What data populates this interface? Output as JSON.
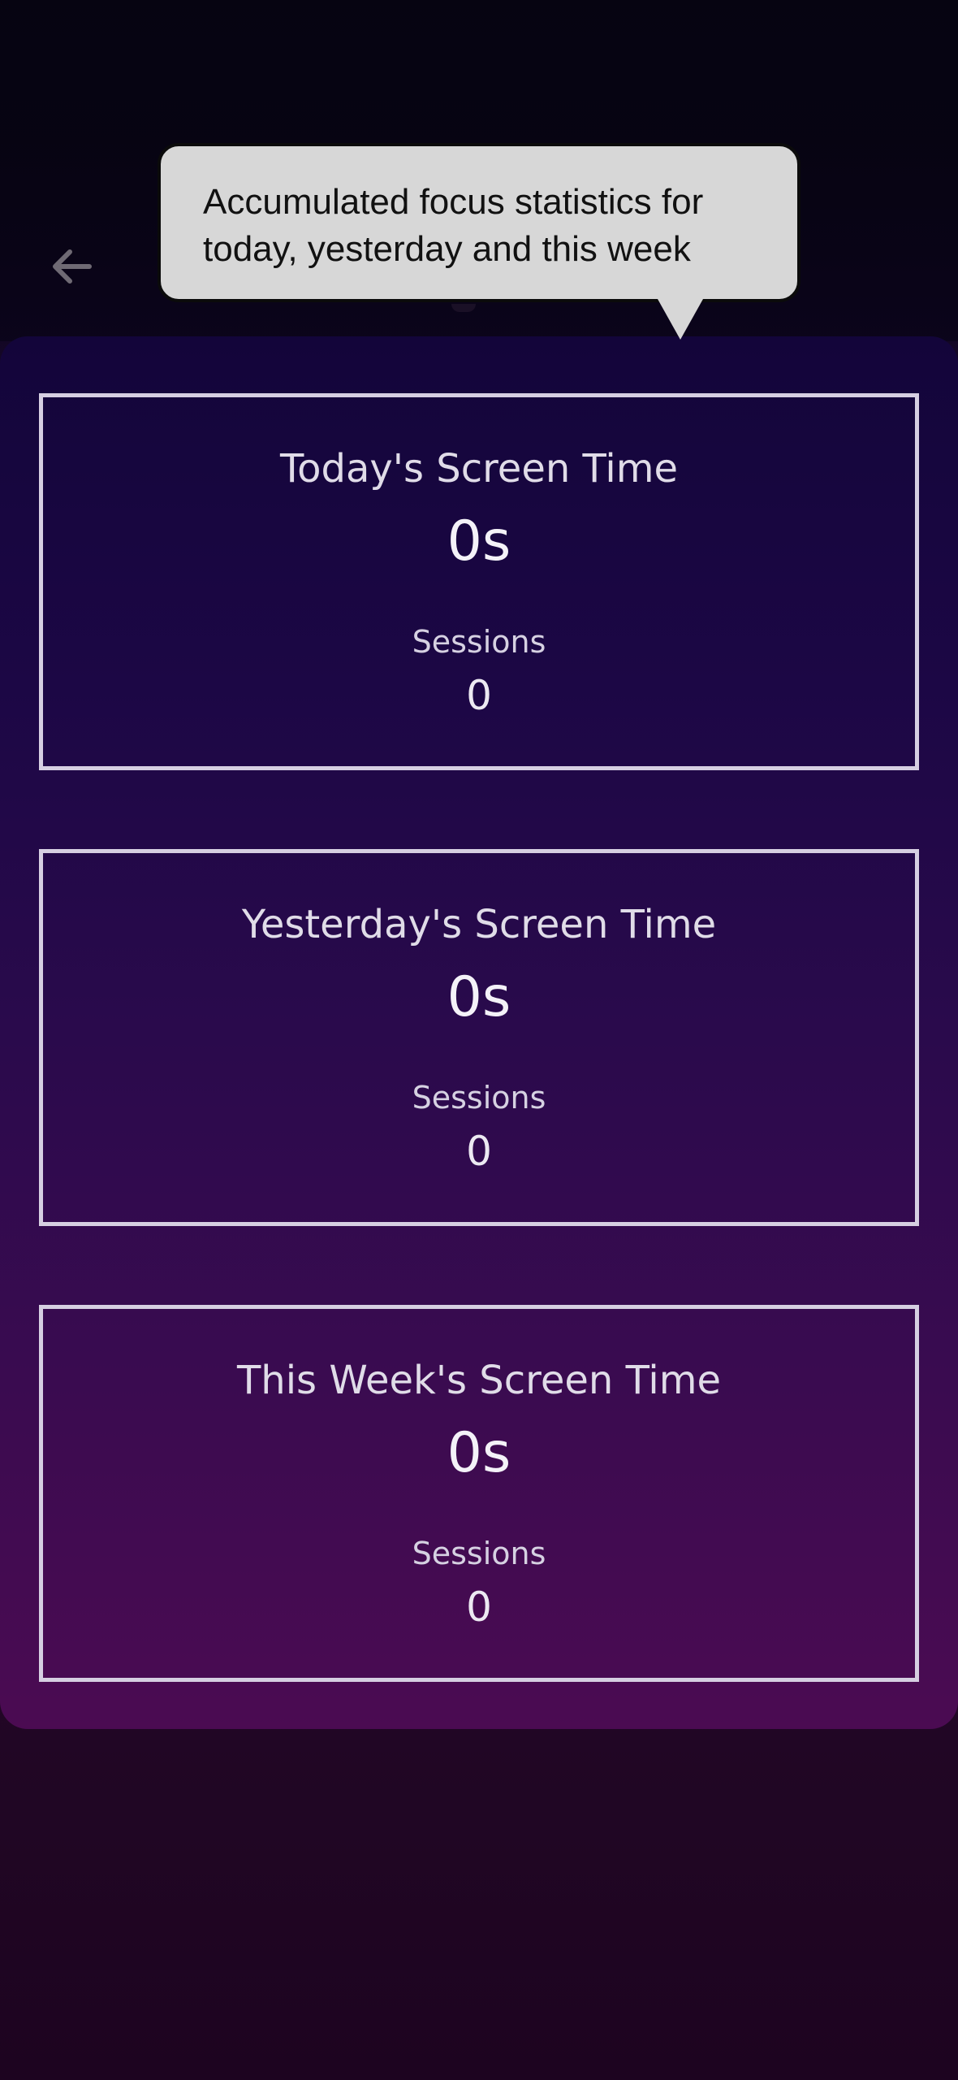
{
  "header": {
    "back_icon": "arrow-left-icon"
  },
  "tooltip": {
    "line1": "Accumulated focus statistics for",
    "line2": "today, yesterday and this week"
  },
  "stats": [
    {
      "title": "Today's Screen Time",
      "time": "0s",
      "sessions_label": "Sessions",
      "sessions_value": "0"
    },
    {
      "title": "Yesterday's Screen Time",
      "time": "0s",
      "sessions_label": "Sessions",
      "sessions_value": "0"
    },
    {
      "title": "This Week's Screen Time",
      "time": "0s",
      "sessions_label": "Sessions",
      "sessions_value": "0"
    }
  ],
  "colors": {
    "card_border": "#d6cfe2",
    "tooltip_bg": "#d7d7d7",
    "panel_top": "#13053a",
    "panel_bottom": "#4b0b52"
  }
}
